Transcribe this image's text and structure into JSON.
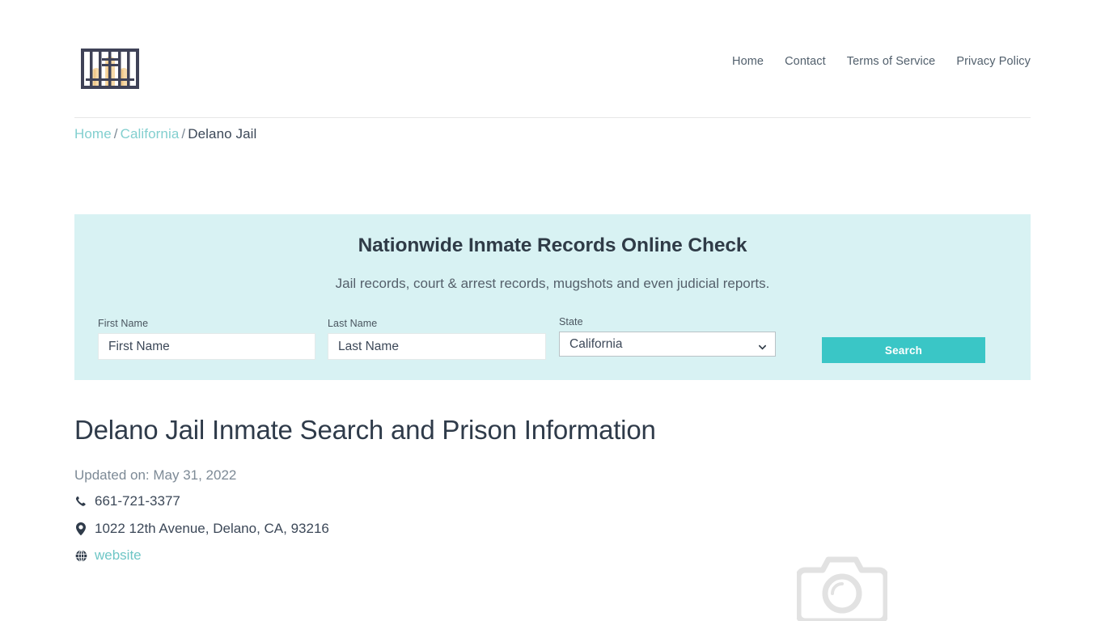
{
  "header": {
    "logo_name": "jail-bars-logo",
    "nav": [
      {
        "label": "Home"
      },
      {
        "label": "Contact"
      },
      {
        "label": "Terms of Service"
      },
      {
        "label": "Privacy Policy"
      }
    ]
  },
  "breadcrumb": {
    "home": "Home",
    "state": "California",
    "current": "Delano Jail",
    "separator": "/"
  },
  "search_panel": {
    "title": "Nationwide Inmate Records Online Check",
    "subtitle": "Jail records, court & arrest records, mugshots and even judicial reports.",
    "first_name": {
      "label": "First Name",
      "value": "",
      "placeholder": "First Name"
    },
    "last_name": {
      "label": "Last Name",
      "value": "",
      "placeholder": "Last Name"
    },
    "state": {
      "label": "State",
      "selected": "California",
      "options": [
        "California"
      ]
    },
    "search_button": "Search",
    "background_color": "#d8f2f3",
    "button_color": "#3ac6c6"
  },
  "main": {
    "title": "Delano Jail Inmate Search and Prison Information",
    "updated": "Updated on: May 31, 2022",
    "phone": "661-721-3377",
    "address": "1022 12th Avenue, Delano, CA, 93216",
    "website_label": "website",
    "link_color": "#6ec6c6"
  }
}
